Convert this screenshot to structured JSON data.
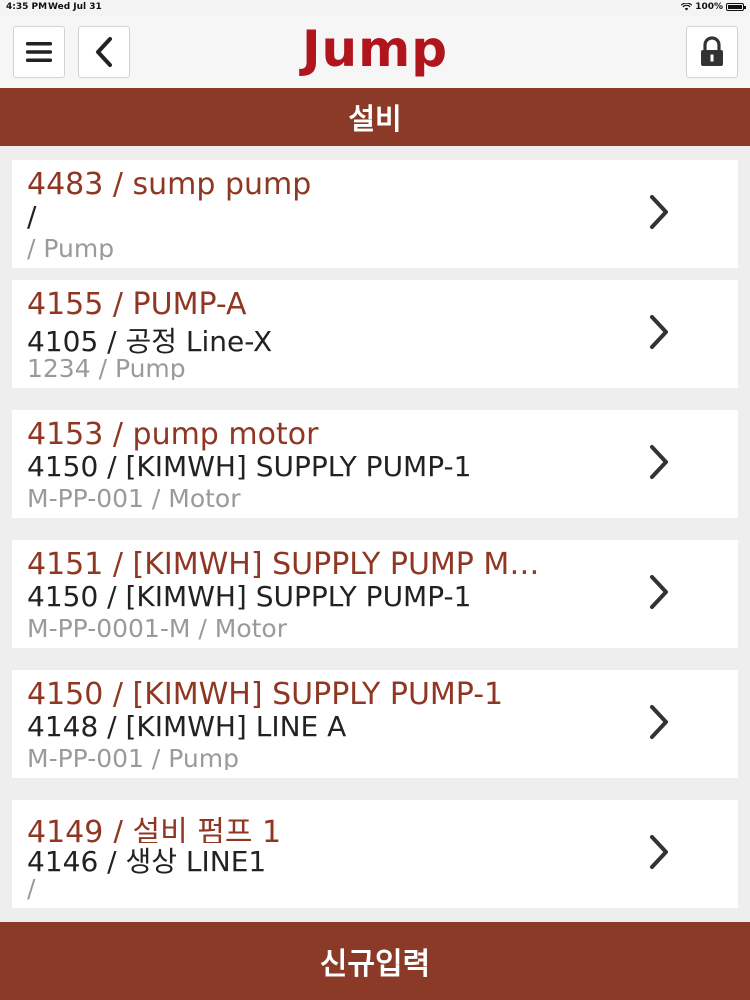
{
  "status_bar": {
    "time": "4:35 PM",
    "date": "Wed Jul 31",
    "battery": "100%",
    "battery_level": 1.0
  },
  "header": {
    "logo": "Jump",
    "menu_icon": "hamburger-icon",
    "back_icon": "chevron-left-icon",
    "lock_icon": "lock-icon"
  },
  "title": "설비",
  "items": [
    {
      "line1": "4483 / sump pump",
      "line2": "/",
      "line3": " / Pump"
    },
    {
      "line1": "4155 / PUMP-A",
      "line2": "4105 / 공정 Line-X",
      "line3": "1234 / Pump"
    },
    {
      "line1": "4153 / pump motor",
      "line2": "4150 / [KIMWH] SUPPLY PUMP-1",
      "line3": "M-PP-001 / Motor"
    },
    {
      "line1": "4151 / [KIMWH] SUPPLY PUMP M…",
      "line2": "4150 / [KIMWH] SUPPLY PUMP-1",
      "line3": "M-PP-0001-M / Motor"
    },
    {
      "line1": "4150 / [KIMWH] SUPPLY PUMP-1",
      "line2": "4148 / [KIMWH] LINE A",
      "line3": "M-PP-001 / Pump"
    },
    {
      "line1": "4149 / 설비 펌프 1",
      "line2": "4146 / 생상 LINE1",
      "line3": " /"
    }
  ],
  "footer": {
    "new_entry_label": "신규입력"
  },
  "colors": {
    "accent": "#8a3a26",
    "logo": "#b0151d",
    "primary_text": "#8f3723"
  }
}
